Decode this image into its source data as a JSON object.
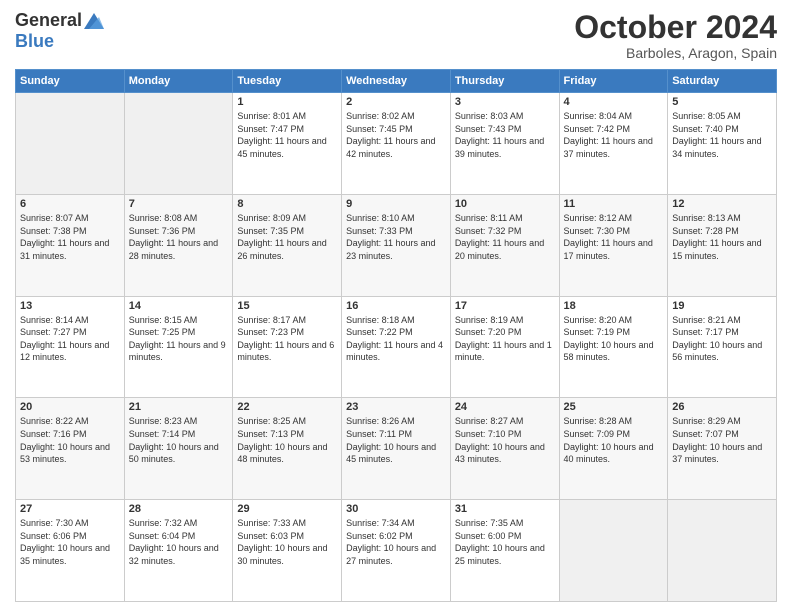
{
  "logo": {
    "general": "General",
    "blue": "Blue"
  },
  "header": {
    "month": "October 2024",
    "location": "Barboles, Aragon, Spain"
  },
  "weekdays": [
    "Sunday",
    "Monday",
    "Tuesday",
    "Wednesday",
    "Thursday",
    "Friday",
    "Saturday"
  ],
  "weeks": [
    [
      {
        "day": null
      },
      {
        "day": null
      },
      {
        "day": "1",
        "sunrise": "Sunrise: 8:01 AM",
        "sunset": "Sunset: 7:47 PM",
        "daylight": "Daylight: 11 hours and 45 minutes."
      },
      {
        "day": "2",
        "sunrise": "Sunrise: 8:02 AM",
        "sunset": "Sunset: 7:45 PM",
        "daylight": "Daylight: 11 hours and 42 minutes."
      },
      {
        "day": "3",
        "sunrise": "Sunrise: 8:03 AM",
        "sunset": "Sunset: 7:43 PM",
        "daylight": "Daylight: 11 hours and 39 minutes."
      },
      {
        "day": "4",
        "sunrise": "Sunrise: 8:04 AM",
        "sunset": "Sunset: 7:42 PM",
        "daylight": "Daylight: 11 hours and 37 minutes."
      },
      {
        "day": "5",
        "sunrise": "Sunrise: 8:05 AM",
        "sunset": "Sunset: 7:40 PM",
        "daylight": "Daylight: 11 hours and 34 minutes."
      }
    ],
    [
      {
        "day": "6",
        "sunrise": "Sunrise: 8:07 AM",
        "sunset": "Sunset: 7:38 PM",
        "daylight": "Daylight: 11 hours and 31 minutes."
      },
      {
        "day": "7",
        "sunrise": "Sunrise: 8:08 AM",
        "sunset": "Sunset: 7:36 PM",
        "daylight": "Daylight: 11 hours and 28 minutes."
      },
      {
        "day": "8",
        "sunrise": "Sunrise: 8:09 AM",
        "sunset": "Sunset: 7:35 PM",
        "daylight": "Daylight: 11 hours and 26 minutes."
      },
      {
        "day": "9",
        "sunrise": "Sunrise: 8:10 AM",
        "sunset": "Sunset: 7:33 PM",
        "daylight": "Daylight: 11 hours and 23 minutes."
      },
      {
        "day": "10",
        "sunrise": "Sunrise: 8:11 AM",
        "sunset": "Sunset: 7:32 PM",
        "daylight": "Daylight: 11 hours and 20 minutes."
      },
      {
        "day": "11",
        "sunrise": "Sunrise: 8:12 AM",
        "sunset": "Sunset: 7:30 PM",
        "daylight": "Daylight: 11 hours and 17 minutes."
      },
      {
        "day": "12",
        "sunrise": "Sunrise: 8:13 AM",
        "sunset": "Sunset: 7:28 PM",
        "daylight": "Daylight: 11 hours and 15 minutes."
      }
    ],
    [
      {
        "day": "13",
        "sunrise": "Sunrise: 8:14 AM",
        "sunset": "Sunset: 7:27 PM",
        "daylight": "Daylight: 11 hours and 12 minutes."
      },
      {
        "day": "14",
        "sunrise": "Sunrise: 8:15 AM",
        "sunset": "Sunset: 7:25 PM",
        "daylight": "Daylight: 11 hours and 9 minutes."
      },
      {
        "day": "15",
        "sunrise": "Sunrise: 8:17 AM",
        "sunset": "Sunset: 7:23 PM",
        "daylight": "Daylight: 11 hours and 6 minutes."
      },
      {
        "day": "16",
        "sunrise": "Sunrise: 8:18 AM",
        "sunset": "Sunset: 7:22 PM",
        "daylight": "Daylight: 11 hours and 4 minutes."
      },
      {
        "day": "17",
        "sunrise": "Sunrise: 8:19 AM",
        "sunset": "Sunset: 7:20 PM",
        "daylight": "Daylight: 11 hours and 1 minute."
      },
      {
        "day": "18",
        "sunrise": "Sunrise: 8:20 AM",
        "sunset": "Sunset: 7:19 PM",
        "daylight": "Daylight: 10 hours and 58 minutes."
      },
      {
        "day": "19",
        "sunrise": "Sunrise: 8:21 AM",
        "sunset": "Sunset: 7:17 PM",
        "daylight": "Daylight: 10 hours and 56 minutes."
      }
    ],
    [
      {
        "day": "20",
        "sunrise": "Sunrise: 8:22 AM",
        "sunset": "Sunset: 7:16 PM",
        "daylight": "Daylight: 10 hours and 53 minutes."
      },
      {
        "day": "21",
        "sunrise": "Sunrise: 8:23 AM",
        "sunset": "Sunset: 7:14 PM",
        "daylight": "Daylight: 10 hours and 50 minutes."
      },
      {
        "day": "22",
        "sunrise": "Sunrise: 8:25 AM",
        "sunset": "Sunset: 7:13 PM",
        "daylight": "Daylight: 10 hours and 48 minutes."
      },
      {
        "day": "23",
        "sunrise": "Sunrise: 8:26 AM",
        "sunset": "Sunset: 7:11 PM",
        "daylight": "Daylight: 10 hours and 45 minutes."
      },
      {
        "day": "24",
        "sunrise": "Sunrise: 8:27 AM",
        "sunset": "Sunset: 7:10 PM",
        "daylight": "Daylight: 10 hours and 43 minutes."
      },
      {
        "day": "25",
        "sunrise": "Sunrise: 8:28 AM",
        "sunset": "Sunset: 7:09 PM",
        "daylight": "Daylight: 10 hours and 40 minutes."
      },
      {
        "day": "26",
        "sunrise": "Sunrise: 8:29 AM",
        "sunset": "Sunset: 7:07 PM",
        "daylight": "Daylight: 10 hours and 37 minutes."
      }
    ],
    [
      {
        "day": "27",
        "sunrise": "Sunrise: 7:30 AM",
        "sunset": "Sunset: 6:06 PM",
        "daylight": "Daylight: 10 hours and 35 minutes."
      },
      {
        "day": "28",
        "sunrise": "Sunrise: 7:32 AM",
        "sunset": "Sunset: 6:04 PM",
        "daylight": "Daylight: 10 hours and 32 minutes."
      },
      {
        "day": "29",
        "sunrise": "Sunrise: 7:33 AM",
        "sunset": "Sunset: 6:03 PM",
        "daylight": "Daylight: 10 hours and 30 minutes."
      },
      {
        "day": "30",
        "sunrise": "Sunrise: 7:34 AM",
        "sunset": "Sunset: 6:02 PM",
        "daylight": "Daylight: 10 hours and 27 minutes."
      },
      {
        "day": "31",
        "sunrise": "Sunrise: 7:35 AM",
        "sunset": "Sunset: 6:00 PM",
        "daylight": "Daylight: 10 hours and 25 minutes."
      },
      {
        "day": null
      },
      {
        "day": null
      }
    ]
  ]
}
